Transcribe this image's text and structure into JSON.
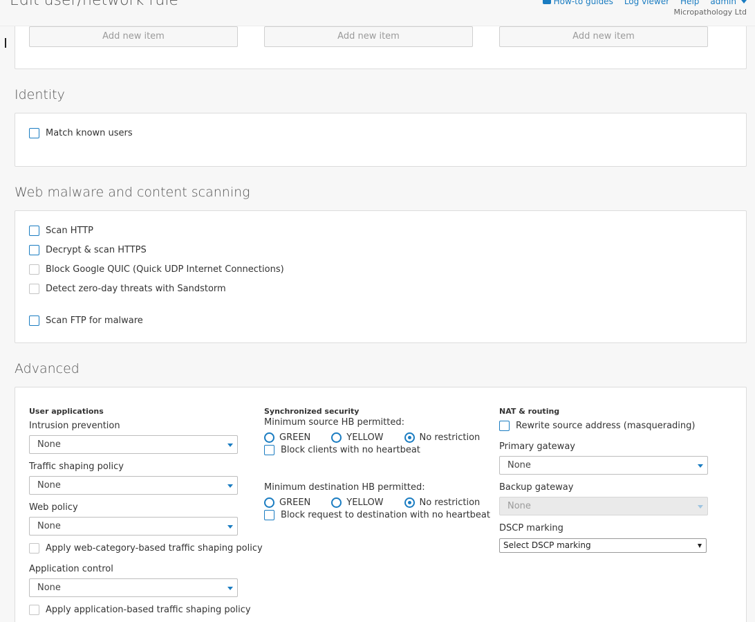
{
  "header": {
    "title": "Edit user/network rule",
    "links": {
      "guides": "How-to guides",
      "logviewer": "Log viewer",
      "help": "Help",
      "user": "admin"
    },
    "company": "Micropathology Ltd"
  },
  "add_items": {
    "label": "Add new item"
  },
  "identity": {
    "title": "Identity",
    "match_known_users": "Match known users"
  },
  "web": {
    "title": "Web malware and content scanning",
    "scan_http": "Scan HTTP",
    "scan_https": "Decrypt & scan HTTPS",
    "block_quic": "Block Google QUIC (Quick UDP Internet Connections)",
    "sandstorm": "Detect zero-day threats with Sandstorm",
    "scan_ftp": "Scan FTP for malware"
  },
  "advanced": {
    "title": "Advanced",
    "user_apps": {
      "heading": "User applications",
      "ips_label": "Intrusion prevention",
      "ips_value": "None",
      "shaping_label": "Traffic shaping policy",
      "shaping_value": "None",
      "web_policy_label": "Web policy",
      "web_policy_value": "None",
      "web_cat_shaping": "Apply web-category-based traffic shaping policy",
      "app_control_label": "Application control",
      "app_control_value": "None",
      "app_shaping": "Apply application-based traffic shaping policy"
    },
    "sync": {
      "heading": "Synchronized security",
      "min_source": "Minimum source HB permitted:",
      "min_dest": "Minimum destination HB permitted:",
      "green": "GREEN",
      "yellow": "YELLOW",
      "no_restriction": "No restriction",
      "block_clients": "Block clients with no heartbeat",
      "block_dest": "Block request to destination with no heartbeat"
    },
    "nat": {
      "heading": "NAT & routing",
      "masquerade": "Rewrite source address (masquerading)",
      "primary_label": "Primary gateway",
      "primary_value": "None",
      "backup_label": "Backup gateway",
      "backup_value": "None",
      "dscp_label": "DSCP marking",
      "dscp_value": "Select DSCP marking"
    }
  },
  "colors": {
    "accent": "#1a7cc1",
    "panel_border": "#dcdcdc"
  }
}
